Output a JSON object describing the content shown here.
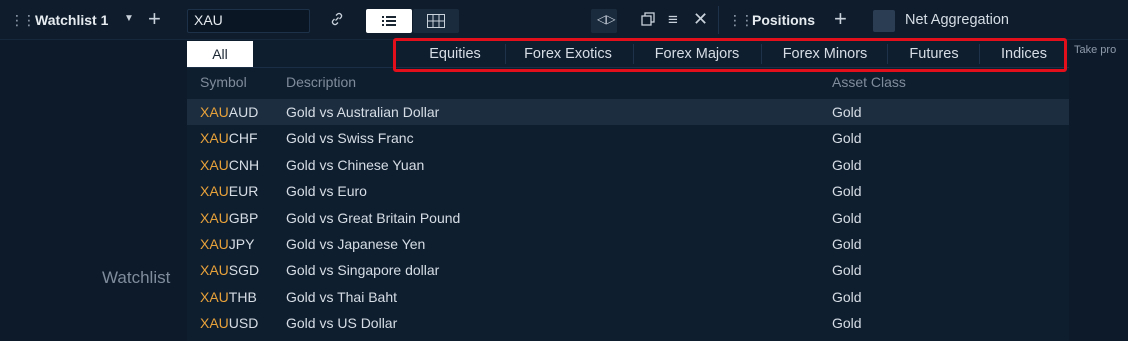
{
  "toolbar": {
    "watchlist_title": "Watchlist 1",
    "search_value": "XAU",
    "positions_title": "Positions",
    "net_aggregation_label": "Net Aggregation"
  },
  "left_pane": {
    "label": "Watchlist"
  },
  "right_strip": {
    "label": "Take pro"
  },
  "dropdown": {
    "tabs": [
      {
        "label": "All",
        "active": true
      },
      {
        "label": "Equities"
      },
      {
        "label": "Forex Exotics"
      },
      {
        "label": "Forex Majors"
      },
      {
        "label": "Forex Minors"
      },
      {
        "label": "Futures"
      },
      {
        "label": "Indices"
      }
    ],
    "columns": [
      "Symbol",
      "Description",
      "Asset Class"
    ],
    "rows": [
      {
        "match": "XAU",
        "rest": "AUD",
        "description": "Gold vs Australian Dollar",
        "asset_class": "Gold",
        "selected": true
      },
      {
        "match": "XAU",
        "rest": "CHF",
        "description": "Gold vs Swiss Franc",
        "asset_class": "Gold"
      },
      {
        "match": "XAU",
        "rest": "CNH",
        "description": "Gold vs Chinese Yuan",
        "asset_class": "Gold"
      },
      {
        "match": "XAU",
        "rest": "EUR",
        "description": "Gold vs Euro",
        "asset_class": "Gold"
      },
      {
        "match": "XAU",
        "rest": "GBP",
        "description": "Gold vs Great Britain Pound",
        "asset_class": "Gold"
      },
      {
        "match": "XAU",
        "rest": "JPY",
        "description": "Gold vs Japanese Yen",
        "asset_class": "Gold"
      },
      {
        "match": "XAU",
        "rest": "SGD",
        "description": "Gold vs Singapore dollar",
        "asset_class": "Gold"
      },
      {
        "match": "XAU",
        "rest": "THB",
        "description": "Gold vs Thai Baht",
        "asset_class": "Gold"
      },
      {
        "match": "XAU",
        "rest": "USD",
        "description": "Gold vs US Dollar",
        "asset_class": "Gold"
      }
    ]
  },
  "colors": {
    "background": "#0c1a2a",
    "match_highlight": "#e8a23a",
    "callout_border": "#e3101b",
    "selected_row": "#1c2d40"
  }
}
